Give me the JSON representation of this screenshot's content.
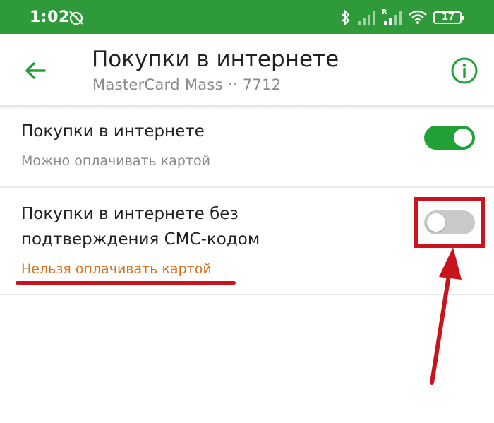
{
  "status": {
    "time": "1:02",
    "battery": "17",
    "icons": [
      "alarm-off-icon",
      "bluetooth-icon",
      "signal-icon",
      "roaming-signal-icon",
      "wifi-icon",
      "battery-icon"
    ]
  },
  "header": {
    "title": "Покупки в интернете",
    "subtitle": "MasterCard Mass ·· 7712",
    "back_icon": "arrow-back-icon",
    "info_icon": "info-icon"
  },
  "settings": [
    {
      "title": "Покупки в интернете",
      "subtitle": "Можно оплачивать картой",
      "enabled": true
    },
    {
      "title_lines": [
        "Покупки в интернете без",
        "подтверждения СМС-кодом"
      ],
      "subtitle": "Нельзя оплачивать картой",
      "enabled": false
    }
  ],
  "colors": {
    "status_bar": "#2f9a3a",
    "accent": "#21a038",
    "warning_text": "#d5701c",
    "annotation": "#c9141e"
  }
}
